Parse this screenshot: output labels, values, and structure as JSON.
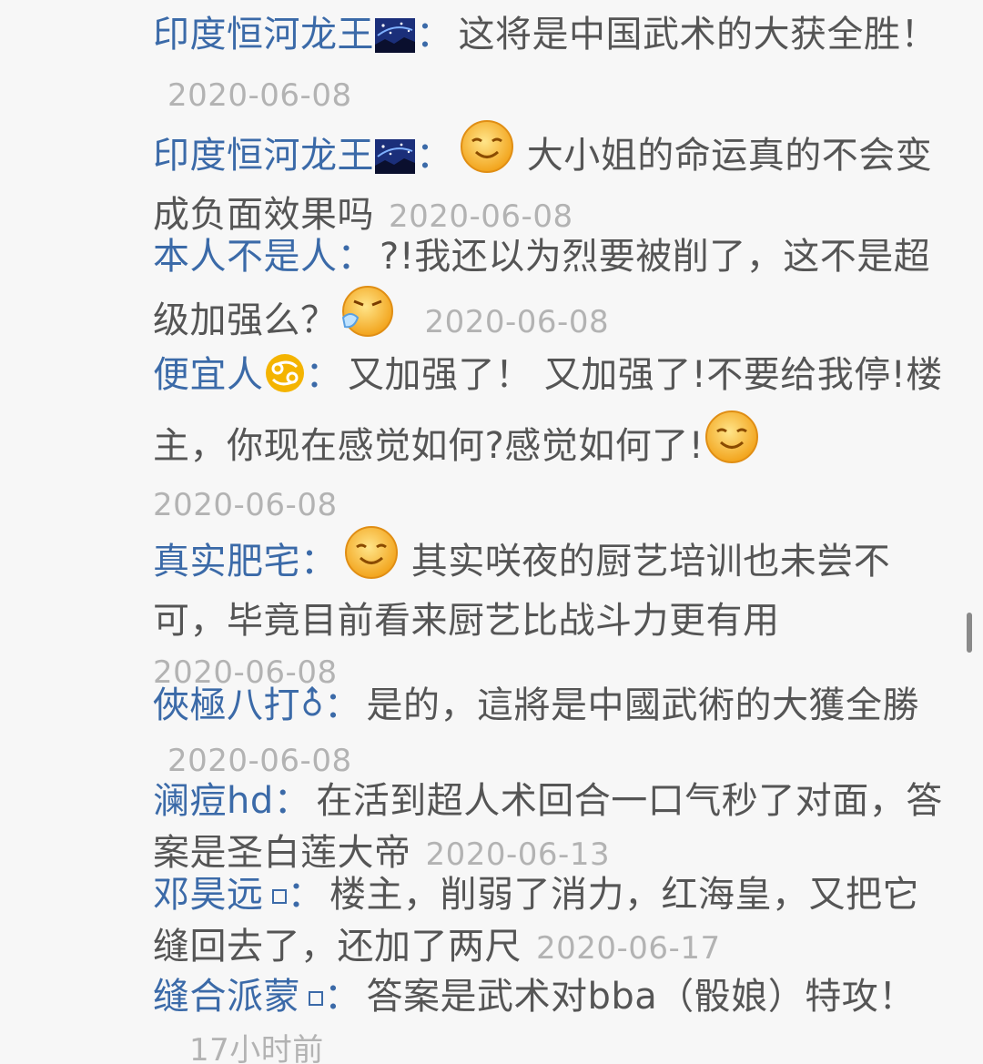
{
  "comments": [
    {
      "user": "印度恒河龙王",
      "sep": "：",
      "text_a": "这将是中国武术的大获全胜！",
      "text_b": "",
      "date": "2020-06-08"
    },
    {
      "user": "印度恒河龙王",
      "sep": "：",
      "text_a": "大小姐的命运真的不会变成负面效果吗",
      "text_b": "",
      "date": "2020-06-08"
    },
    {
      "user": "本人不是人",
      "sep": "：",
      "text_a": "?!我还以为烈要被削了，这不是超级加强么？",
      "text_b": "",
      "date": "2020-06-08"
    },
    {
      "user": "便宜人",
      "sep": "：",
      "text_a": "又加强了！ 又加强了!不要给我停!楼主，你现在感觉如何?感觉如何了!",
      "text_b": "",
      "date": "2020-06-08"
    },
    {
      "user": "真实肥宅",
      "sep": "：",
      "text_a": "其实咲夜的厨艺培训也未尝不可，毕竟目前看来厨艺比战斗力更有用",
      "text_b": "",
      "date": "2020-06-08"
    },
    {
      "user": "俠極八打",
      "sep": "：",
      "text_a": "是的，這將是中國武術的大獲全勝",
      "text_b": "",
      "date": "2020-06-08"
    },
    {
      "user": "澜痘hd",
      "sep": "：",
      "text_a": "在活到超人术回合一口气秒了对面，答案是圣白莲大帝",
      "text_b": "",
      "date": "2020-06-13"
    },
    {
      "user": "邓昊远",
      "sep": "：",
      "text_a": "楼主，削弱了消力，红海皇，又把它缝回去了，还加了两尺",
      "text_b": "",
      "date": "2020-06-17"
    },
    {
      "user": "缝合派蒙",
      "sep": "：",
      "text_a": "答案是武术对bba（骰娘）特攻！",
      "text_b": "",
      "date": "17小时前"
    }
  ],
  "icons": {
    "night_sky": "night-sky-icon",
    "smile": "smile-emoji-icon",
    "sneeze": "sneeze-emoji-icon",
    "cancer": "cancer-zodiac-icon",
    "male": "male-symbol-icon",
    "badge": "small-square-badge-icon"
  },
  "colors": {
    "username": "#3b6aa8",
    "content": "#555555",
    "date": "#b3b3b3",
    "background": "#f7f7f7"
  }
}
